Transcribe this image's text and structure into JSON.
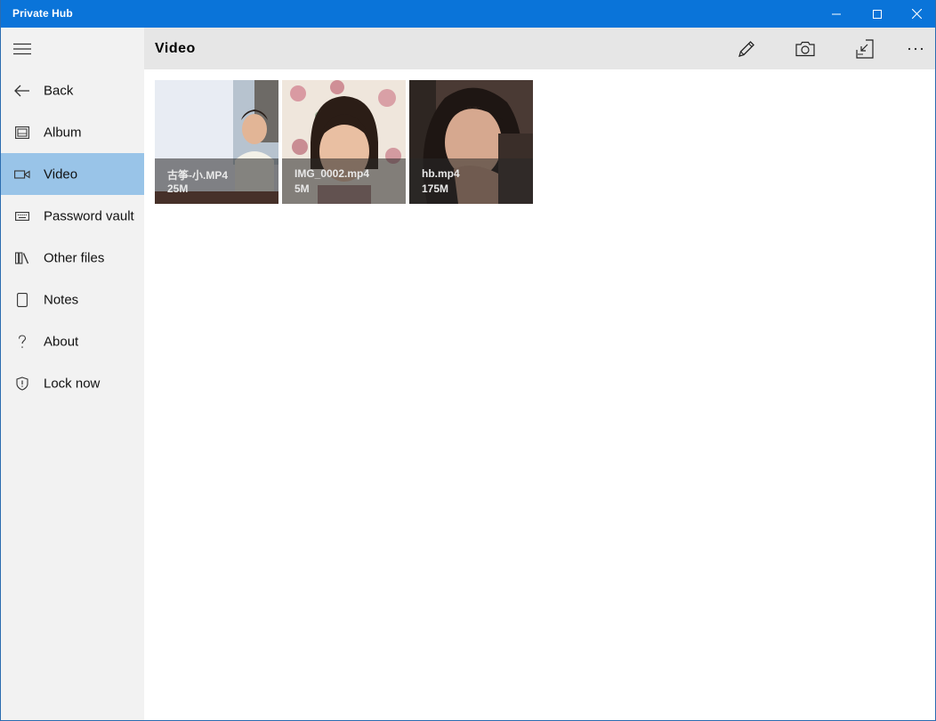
{
  "window": {
    "title": "Private Hub",
    "titlebar_color": "#0a74d9",
    "controls": [
      "minimize-icon",
      "maximize-icon",
      "close-icon"
    ]
  },
  "sidebar": {
    "menu_icon": "hamburger-icon",
    "active_color": "#99c4e8",
    "items": [
      {
        "label": "Back",
        "icon": "back-arrow-icon",
        "active": false
      },
      {
        "label": "Album",
        "icon": "album-icon",
        "active": false
      },
      {
        "label": "Video",
        "icon": "video-camera-icon",
        "active": true
      },
      {
        "label": "Password vault",
        "icon": "keyboard-icon",
        "active": false
      },
      {
        "label": "Other files",
        "icon": "library-icon",
        "active": false
      },
      {
        "label": "Notes",
        "icon": "note-icon",
        "active": false
      },
      {
        "label": "About",
        "icon": "question-icon",
        "active": false
      },
      {
        "label": "Lock now",
        "icon": "shield-icon",
        "active": false
      }
    ]
  },
  "header": {
    "title": "Video",
    "tools": [
      "edit-pencil-icon",
      "camera-icon",
      "import-icon",
      "more-icon"
    ]
  },
  "videos": [
    {
      "name": "古筝-小.MP4",
      "size": "25M"
    },
    {
      "name": "IMG_0002.mp4",
      "size": "5M"
    },
    {
      "name": "hb.mp4",
      "size": "175M"
    }
  ]
}
